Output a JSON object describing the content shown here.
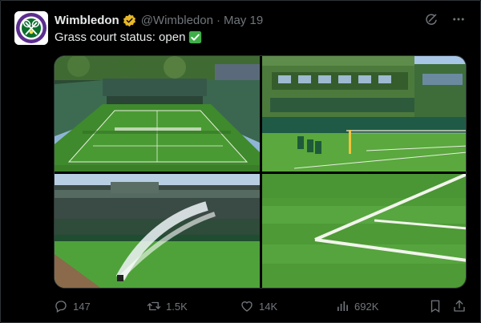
{
  "tweet": {
    "author_name": "Wimbledon",
    "handle": "@Wimbledon",
    "separator": "·",
    "date": "May 19",
    "text": "Grass court status: open",
    "emoji": "check-mark-button"
  },
  "avatar": {
    "icon": "wimbledon-logo",
    "colors": {
      "purple": "#5b2d8e",
      "green": "#0a6d2c",
      "white": "#ffffff"
    }
  },
  "media": {
    "images": [
      {
        "name": "centre-court-image",
        "desc_icon": "stadium"
      },
      {
        "name": "court-with-chairs-image",
        "desc_icon": "ivy-stadium"
      },
      {
        "name": "sprinkler-image",
        "desc_icon": "sprinkler"
      },
      {
        "name": "court-lines-image",
        "desc_icon": "lines"
      }
    ]
  },
  "actions": {
    "replies": "147",
    "retweets": "1.5K",
    "likes": "14K",
    "views": "692K"
  },
  "icons": {
    "top_right": [
      "grok-icon",
      "more-icon"
    ],
    "bar": [
      "reply-icon",
      "retweet-icon",
      "like-icon",
      "views-icon",
      "bookmark-icon",
      "share-icon"
    ]
  },
  "colors": {
    "background": "#000000",
    "text": "#e7e9ea",
    "secondary": "#71767b",
    "verified_gold": "#e8b829",
    "emoji_green": "#3fae49"
  }
}
